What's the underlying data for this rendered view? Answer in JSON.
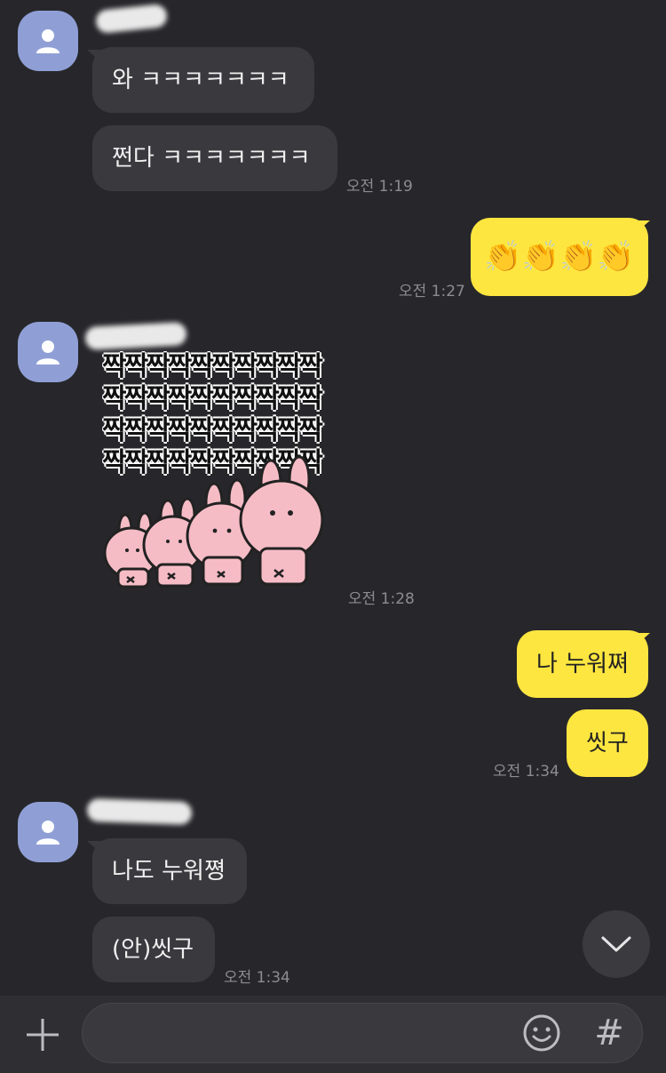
{
  "messages": [
    {
      "text": "와 ㅋㅋㅋㅋㅋㅋㅋ"
    },
    {
      "text": "쩐다 ㅋㅋㅋㅋㅋㅋㅋ",
      "time": "오전 1:19"
    },
    {
      "text": "👏👏👏👏",
      "time": "오전 1:27"
    },
    {
      "time": "오전 1:28"
    },
    {
      "text": "나 누워쪄"
    },
    {
      "text": "씻구",
      "time": "오전 1:34"
    },
    {
      "text": "나도 누워쪙"
    },
    {
      "text": "(안)씻구",
      "time": "오전 1:34"
    }
  ],
  "sticker": {
    "text": "짝짝짝짝짝짝짝짝짝짝짝짝짝짝짝짝짝짝짝짝짝짝짝짝짝짝짝짝짝짝짝짝짝짝짝짝짝짝짝짝",
    "colors": {
      "body": "#f6bcc6",
      "outline": "#222222"
    }
  },
  "composer": {
    "input_value": ""
  },
  "icons": {
    "avatar": "person-icon",
    "scroll": "chevron-down-icon",
    "attach": "plus-icon",
    "emoji": "smiley-icon",
    "hash": "#"
  },
  "colors": {
    "background": "#27272b",
    "incoming_bubble": "#3a3a3e",
    "outgoing_bubble": "#fee640",
    "avatar": "#8f9fd6"
  }
}
